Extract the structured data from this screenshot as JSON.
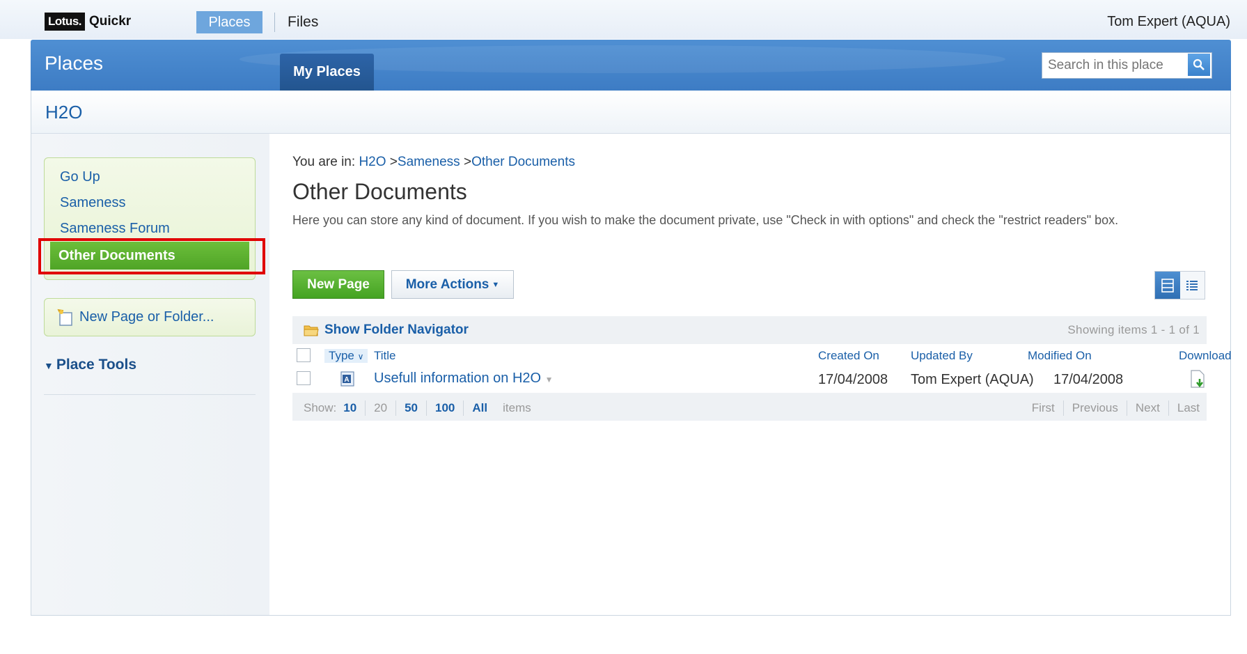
{
  "topbar": {
    "logo_lotus": "Lotus.",
    "logo_quickr": "Quickr",
    "nav_places": "Places",
    "nav_files": "Files",
    "user": "Tom Expert (AQUA)"
  },
  "header": {
    "title": "Places",
    "tab_my_places": "My Places",
    "search_placeholder": "Search in this place"
  },
  "place": {
    "title": "H2O"
  },
  "sidebar": {
    "items": [
      "Go Up",
      "Sameness",
      "Sameness Forum"
    ],
    "active_item": "Other Documents",
    "new_page_or_folder": "New Page or Folder...",
    "place_tools": "Place Tools"
  },
  "content": {
    "breadcrumb_prefix": "You are in: ",
    "breadcrumb": [
      "H2O",
      "Sameness",
      "Other Documents"
    ],
    "breadcrumb_sep": ">",
    "title": "Other Documents",
    "description": "Here you can store any kind of document. If you wish to make the document private, use \"Check in with options\" and check the \"restrict readers\" box.",
    "new_page_button": "New Page",
    "more_actions_button": "More Actions",
    "folder_navigator": "Show Folder Navigator",
    "showing": "Showing items  1  -  1  of  1",
    "columns": {
      "type": "Type",
      "title": "Title",
      "created_on": "Created On",
      "updated_by": "Updated By",
      "modified_on": "Modified On",
      "download": "Download"
    },
    "rows": [
      {
        "title": "Usefull information on H2O",
        "created_on": "17/04/2008",
        "updated_by": "Tom Expert (AQUA)",
        "modified_on": "17/04/2008"
      }
    ],
    "pager": {
      "show_label": "Show:",
      "sizes": [
        "10",
        "20",
        "50",
        "100",
        "All"
      ],
      "items_label": "items",
      "first": "First",
      "previous": "Previous",
      "next": "Next",
      "last": "Last"
    }
  },
  "colors": {
    "brand_blue": "#3d7cc4",
    "link": "#1a5fa8",
    "active_green": "#4fa426",
    "highlight_red": "#e00000"
  },
  "icons": [
    "search-icon",
    "new-folder-icon",
    "folder-icon",
    "document-icon",
    "download-icon",
    "detail-view-icon",
    "list-view-icon",
    "dropdown-caret-icon"
  ]
}
